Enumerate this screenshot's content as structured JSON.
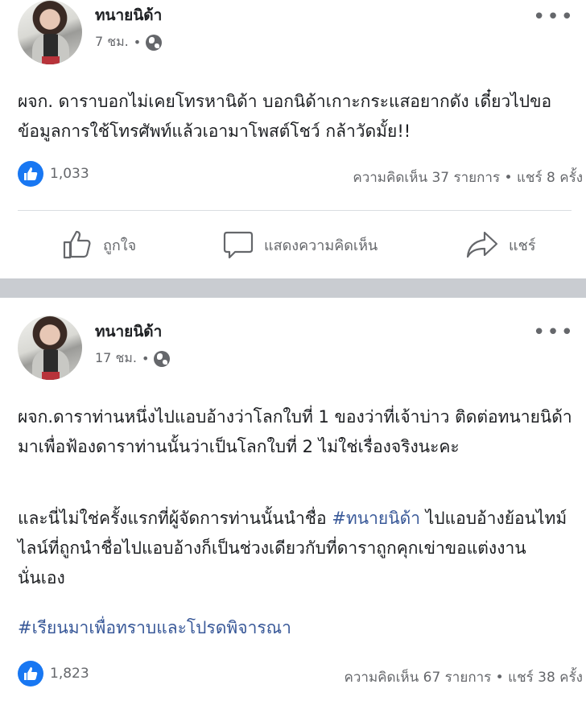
{
  "posts": [
    {
      "author": "ทนายนิด้า",
      "time": "7 ชม.",
      "dot": "•",
      "body": "ผจก. ดาราบอกไม่เคยโทรหานิด้า บอกนิด้าเกาะกระแสอยากดัง เดี๋ยวไปขอข้อมูลการใช้โทรศัพท์แล้วเอามาโพสต์โชว์ กล้าวัดมั้ย!!",
      "likes": "1,033",
      "stats": "ความคิดเห็น 37 รายการ • แชร์ 8 ครั้ง",
      "actions": {
        "like": "ถูกใจ",
        "comment": "แสดงความคิดเห็น",
        "share": "แชร์"
      }
    },
    {
      "author": "ทนายนิด้า",
      "time": "17 ชม.",
      "dot": "•",
      "body1": "ผจก.ดาราท่านหนึ่งไปแอบอ้างว่าโลกใบที่ 1 ของว่าที่เจ้าบ่าว ติดต่อทนายนิด้ามาเพื่อฟ้องดาราท่านนั้นว่าเป็นโลกใบที่ 2 ไม่ใช่เรื่องจริงนะคะ",
      "body2_pre": "และนี่ไม่ใช่ครั้งแรกที่ผู้จัดการท่านนั้นนำชื่อ ",
      "body2_tag": "#ทนายนิด้า",
      "body2_post": " ไปแอบอ้างย้อนไทม์ไลน์ที่ถูกนำชื่อไปแอบอ้างก็เป็นช่วงเดียวกับที่ดาราถูกคุกเข่าขอแต่งงานนั่นเอง",
      "hashtag_line": "#เรียนมาเพื่อทราบและโปรดพิจารณา",
      "likes": "1,823",
      "stats": "ความคิดเห็น 67 รายการ • แชร์ 38 ครั้ง"
    }
  ],
  "more_icon": "•••",
  "colors": {
    "link": "#385898",
    "like": "#1877f2",
    "separator": "#c9ccd1"
  }
}
